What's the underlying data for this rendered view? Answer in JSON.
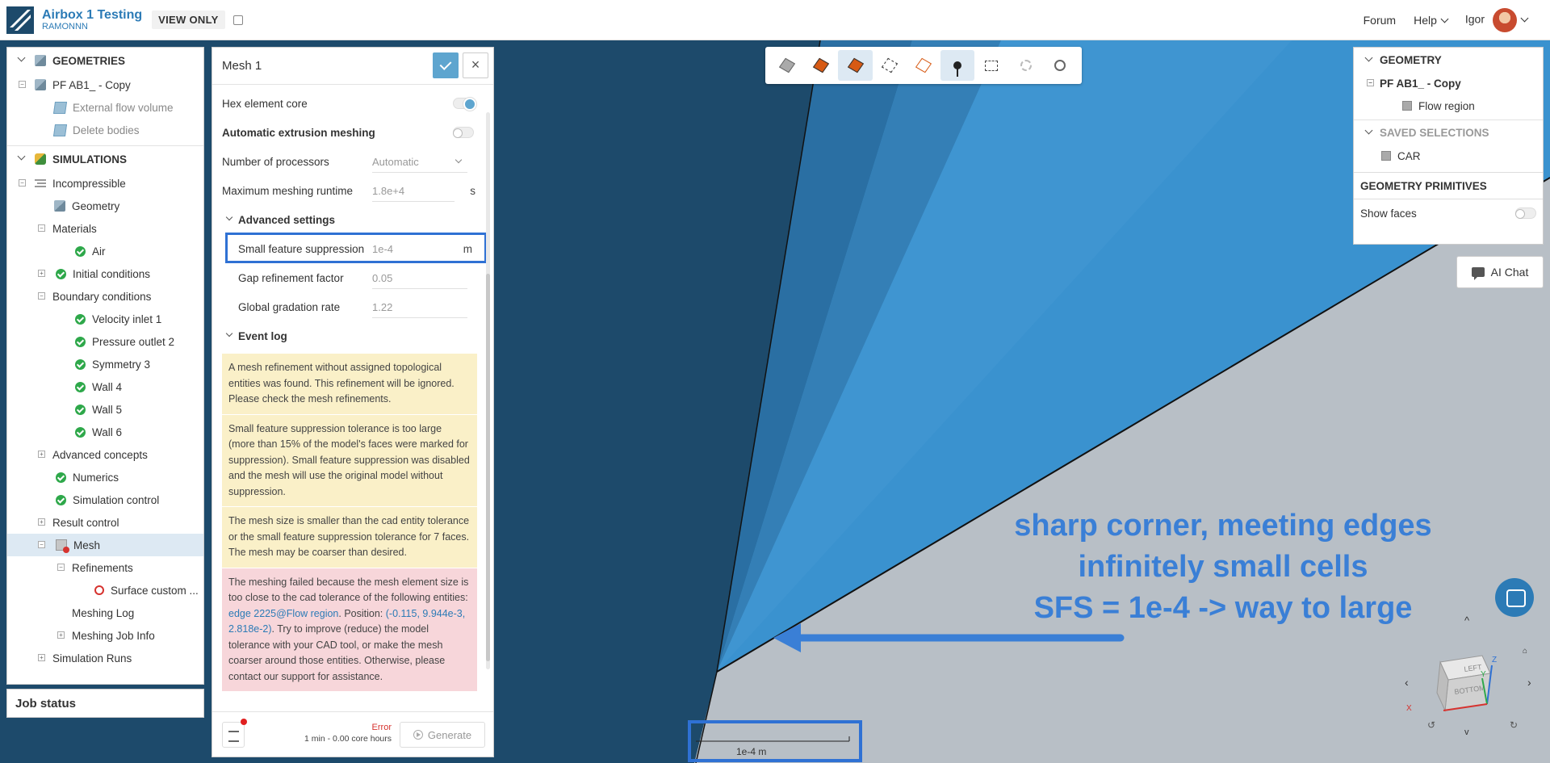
{
  "header": {
    "app_title": "Airbox 1 Testing",
    "owner": "RAMONNN",
    "view_only": "VIEW ONLY",
    "forum": "Forum",
    "help": "Help",
    "user": "Igor"
  },
  "left_tree": {
    "geometries_label": "GEOMETRIES",
    "geometry_name": "PF AB1_ - Copy",
    "geometry_ops": [
      "External flow volume",
      "Delete bodies"
    ],
    "simulations_label": "SIMULATIONS",
    "sim_name": "Incompressible",
    "items": {
      "geometry": "Geometry",
      "materials": "Materials",
      "air": "Air",
      "initial_conditions": "Initial conditions",
      "boundary_conditions": "Boundary conditions",
      "bcs": [
        "Velocity inlet 1",
        "Pressure outlet 2",
        "Symmetry 3",
        "Wall 4",
        "Wall 5",
        "Wall 6"
      ],
      "advanced_concepts": "Advanced concepts",
      "numerics": "Numerics",
      "simulation_control": "Simulation control",
      "result_control": "Result control",
      "mesh": "Mesh",
      "refinements": "Refinements",
      "surface_custom": "Surface custom ...",
      "meshing_log": "Meshing Log",
      "meshing_job_info": "Meshing Job Info",
      "simulation_runs": "Simulation Runs"
    },
    "job_status": "Job status"
  },
  "mesh_panel": {
    "title": "Mesh 1",
    "hex_core": "Hex element core",
    "auto_extrusion": "Automatic extrusion meshing",
    "num_processors": "Number of processors",
    "num_processors_value": "Automatic",
    "max_runtime": "Maximum meshing runtime",
    "max_runtime_value": "1.8e+4",
    "max_runtime_unit": "s",
    "advanced_settings": "Advanced settings",
    "sfs": "Small feature suppression",
    "sfs_value": "1e-4",
    "sfs_unit": "m",
    "gap_refinement": "Gap refinement factor",
    "gap_refinement_value": "0.05",
    "gradation": "Global gradation rate",
    "gradation_value": "1.22",
    "event_log": "Event log",
    "log": [
      "A mesh refinement without assigned topological entities was found. This refinement will be ignored. Please check the mesh refinements.",
      "Small feature suppression tolerance is too large (more than 15% of the model's faces were marked for suppression). Small feature suppression was disabled and the mesh will use the original model without suppression.",
      "The mesh size is smaller than the cad entity tolerance or the small feature suppression tolerance for 7 faces. The mesh may be coarser than desired."
    ],
    "error_log": {
      "pre": "The meshing failed because the mesh element size is too close to the cad tolerance of the following entities: ",
      "entity": "edge 2225@Flow region",
      "mid": ". Position: ",
      "position": "(-0.115, 9.944e-3, 2.818e-2)",
      "post": ". Try to improve (reduce) the model tolerance with your CAD tool, or make the mesh coarser around those entities. Otherwise, please contact our support for assistance."
    },
    "status": "Error",
    "status_detail": "1 min - 0.00 core hours",
    "generate": "Generate"
  },
  "right_panel": {
    "geometry_label": "GEOMETRY",
    "geometry_name": "PF AB1_ - Copy",
    "flow_region": "Flow region",
    "saved_selections": "SAVED SELECTIONS",
    "car": "CAR",
    "primitives": "GEOMETRY PRIMITIVES",
    "show_faces": "Show faces"
  },
  "ai_chat": "AI Chat",
  "annotation": {
    "lines": [
      "sharp corner, meeting edges",
      "infinitely small cells",
      "SFS = 1e-4 -> way to large"
    ]
  },
  "scale": "1e-4 m",
  "navcube": {
    "face_top": "LEFT",
    "face_front": "BOTTOM",
    "axis_z": "Z",
    "axis_y": "Y",
    "axis_x": "X"
  },
  "colors": {
    "accent": "#2c7bb6",
    "annotation": "#3a7fd6",
    "highlight": "#2f71d4",
    "error": "#d6332f",
    "ok": "#2ea84a"
  }
}
